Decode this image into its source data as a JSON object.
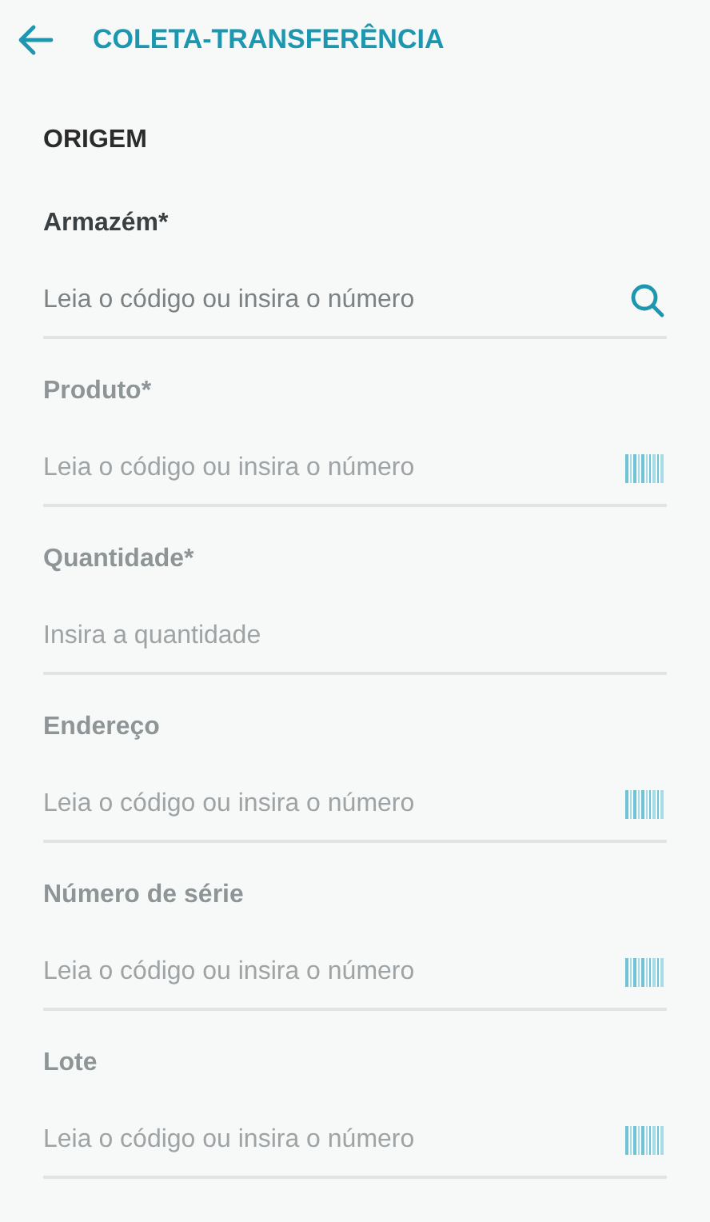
{
  "header": {
    "title": "COLETA-TRANSFERÊNCIA"
  },
  "section": {
    "title": "ORIGEM"
  },
  "fields": [
    {
      "label": "Armazém*",
      "placeholder": "Leia o código ou insira o número",
      "disabled": false,
      "kind": "search"
    },
    {
      "label": "Produto*",
      "placeholder": "Leia o código ou insira o número",
      "disabled": true,
      "kind": "barcode"
    },
    {
      "label": "Quantidade*",
      "placeholder": "Insira a quantidade",
      "disabled": true,
      "kind": "plain"
    },
    {
      "label": "Endereço",
      "placeholder": "Leia o código ou insira o número",
      "disabled": true,
      "kind": "barcode"
    },
    {
      "label": "Número de série",
      "placeholder": "Leia o código ou insira o número",
      "disabled": true,
      "kind": "barcode"
    },
    {
      "label": "Lote",
      "placeholder": "Leia o código ou insira o número",
      "disabled": true,
      "kind": "barcode"
    }
  ]
}
